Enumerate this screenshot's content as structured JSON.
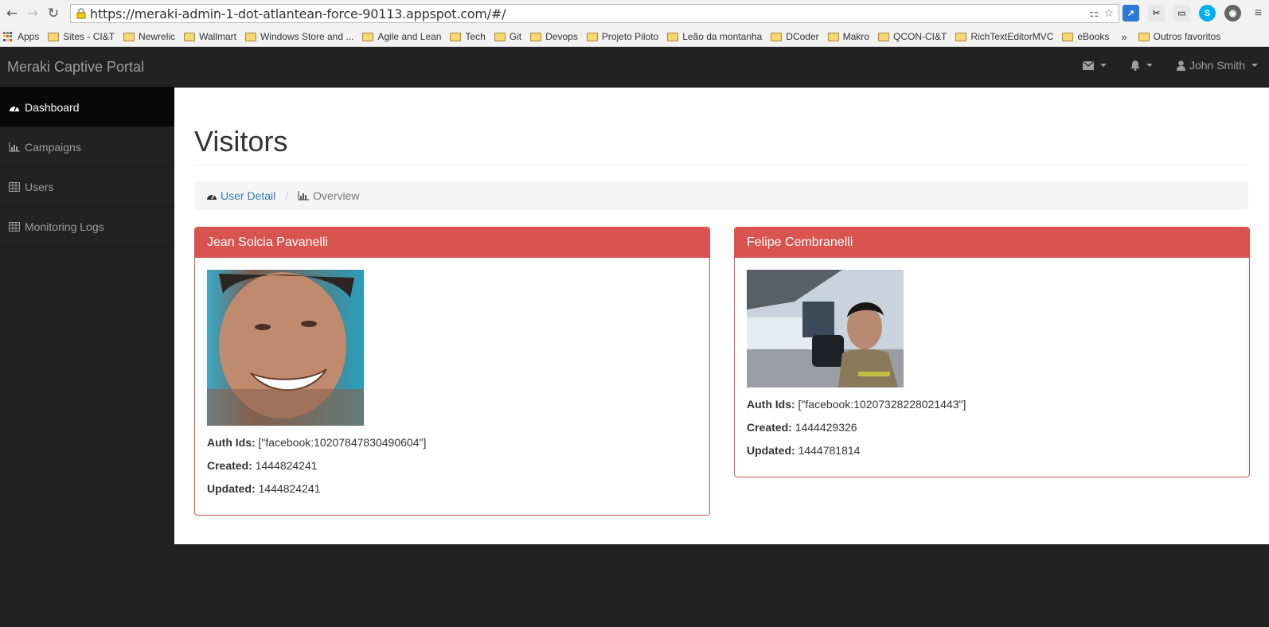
{
  "browser": {
    "url": "https://meraki-admin-1-dot-atlantean-force-90113.appspot.com/#/",
    "bookmarks": [
      "Sites - CI&T",
      "Newrelic",
      "Wallmart",
      "Windows Store and ...",
      "Agile and Lean",
      "Tech",
      "Git",
      "Devops",
      "Projeto Piloto",
      "Leão da montanha",
      "DCoder",
      "Makro",
      "QCON-CI&T",
      "RichTextEditorMVC",
      "eBooks"
    ],
    "apps_label": "Apps",
    "more_label": "»",
    "other_bookmarks": "Outros favoritos"
  },
  "navbar": {
    "brand": "Meraki Captive Portal",
    "user_name": "John Smith"
  },
  "sidebar": {
    "items": [
      {
        "label": "Dashboard",
        "icon": "dashboard-icon",
        "active": true
      },
      {
        "label": "Campaigns",
        "icon": "bar-chart-icon",
        "active": false
      },
      {
        "label": "Users",
        "icon": "table-icon",
        "active": false
      },
      {
        "label": "Monitoring Logs",
        "icon": "table-icon",
        "active": false
      }
    ]
  },
  "main": {
    "title": "Visitors",
    "breadcrumb": {
      "link": "User Detail",
      "sep": "/",
      "active": "Overview"
    },
    "visitors": [
      {
        "name": "Jean Solcia Pavanelli",
        "auth_label": "Auth Ids:",
        "auth_ids": "[\"facebook:10207847830490604\"]",
        "created_label": "Created:",
        "created": "1444824241",
        "updated_label": "Updated:",
        "updated": "1444824241"
      },
      {
        "name": "Felipe Cembranelli",
        "auth_label": "Auth Ids:",
        "auth_ids": "[\"facebook:10207328228021443\"]",
        "created_label": "Created:",
        "created": "1444429326",
        "updated_label": "Updated:",
        "updated": "1444781814"
      }
    ]
  },
  "colors": {
    "panel_danger": "#d9534f",
    "link": "#337ab7",
    "navbar": "#222222"
  }
}
